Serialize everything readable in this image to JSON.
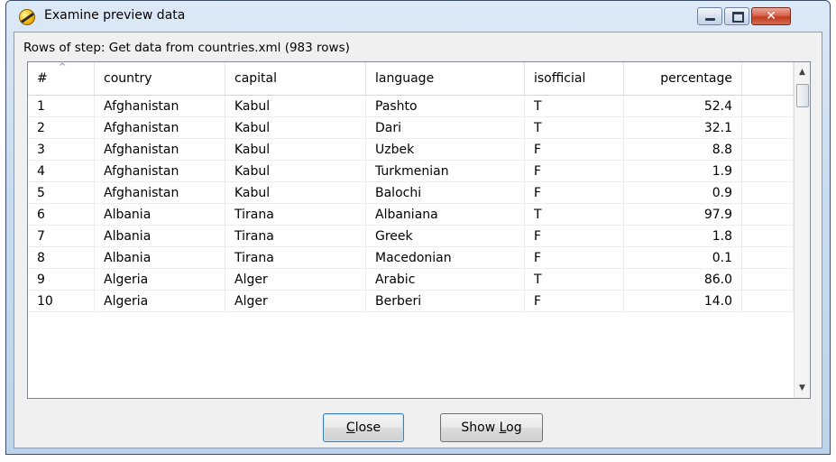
{
  "window": {
    "title": "Examine preview data",
    "icon": "kettle-spoon-icon",
    "controls": {
      "minimize": "minimize-icon",
      "maximize": "maximize-icon",
      "close": "close-icon",
      "close_glyph": "✕"
    }
  },
  "subtitle": "Rows of step: Get data from countries.xml (983 rows)",
  "table": {
    "columns": [
      "#",
      "country",
      "capital",
      "language",
      "isofficial",
      "percentage"
    ],
    "rows": [
      [
        "1",
        "Afghanistan",
        "Kabul",
        "Pashto",
        "T",
        "52.4"
      ],
      [
        "2",
        "Afghanistan",
        "Kabul",
        "Dari",
        "T",
        "32.1"
      ],
      [
        "3",
        "Afghanistan",
        "Kabul",
        "Uzbek",
        "F",
        "8.8"
      ],
      [
        "4",
        "Afghanistan",
        "Kabul",
        "Turkmenian",
        "F",
        "1.9"
      ],
      [
        "5",
        "Afghanistan",
        "Kabul",
        "Balochi",
        "F",
        "0.9"
      ],
      [
        "6",
        "Albania",
        "Tirana",
        "Albaniana",
        "T",
        "97.9"
      ],
      [
        "7",
        "Albania",
        "Tirana",
        "Greek",
        "F",
        "1.8"
      ],
      [
        "8",
        "Albania",
        "Tirana",
        "Macedonian",
        "F",
        "0.1"
      ],
      [
        "9",
        "Algeria",
        "Alger",
        "Arabic",
        "T",
        "86.0"
      ],
      [
        "10",
        "Algeria",
        "Alger",
        "Berberi",
        "F",
        "14.0"
      ]
    ]
  },
  "buttons": {
    "close": {
      "pre": "",
      "mnemonic": "C",
      "post": "lose"
    },
    "show_log": {
      "pre": "Show ",
      "mnemonic": "L",
      "post": "og"
    }
  },
  "colors": {
    "title_gradient_top": "#dce9f7",
    "close_button": "#c23a1f",
    "dialog_bg": "#f0f0f0"
  }
}
